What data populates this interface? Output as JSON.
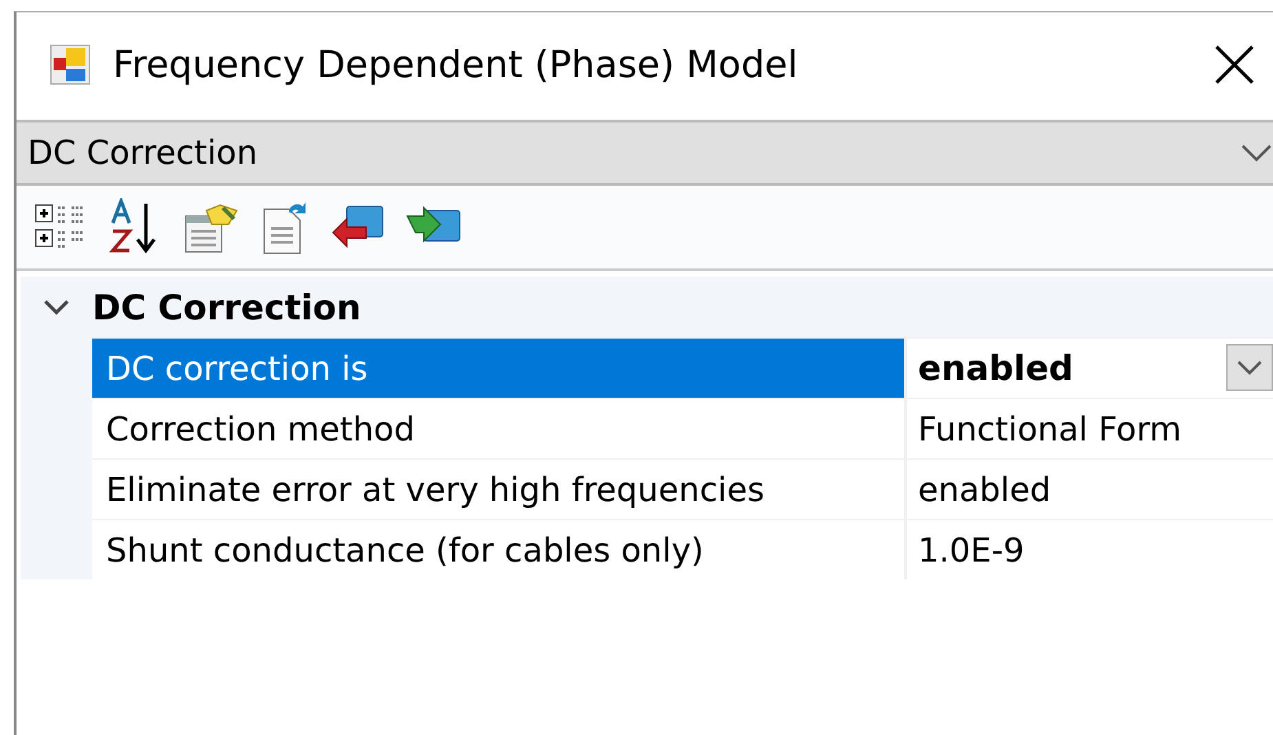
{
  "window": {
    "title": "Frequency Dependent (Phase) Model"
  },
  "object_selector": {
    "value": "DC Correction"
  },
  "toolbar": [
    {
      "kind": "categorized"
    },
    {
      "kind": "alphabetical"
    },
    {
      "kind": "properties"
    },
    {
      "kind": "pages"
    },
    {
      "kind": "import"
    },
    {
      "kind": "export"
    }
  ],
  "categories": [
    {
      "name": "DC Correction",
      "expanded": true,
      "properties": [
        {
          "name": "DC correction is",
          "value": "enabled",
          "selected": true,
          "modified": true
        },
        {
          "name": "Correction method",
          "value": "Functional Form",
          "selected": false,
          "modified": false
        },
        {
          "name": "Eliminate error at very high frequencies",
          "value": "enabled",
          "selected": false,
          "modified": false
        },
        {
          "name": "Shunt conductance (for cables only)",
          "value": "1.0E-9",
          "selected": false,
          "modified": false
        }
      ]
    }
  ]
}
